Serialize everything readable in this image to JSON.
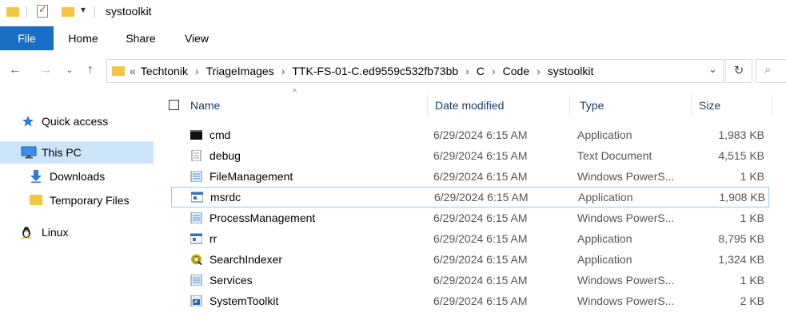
{
  "window": {
    "title": "systoolkit"
  },
  "ribbon": {
    "tabs": [
      "File",
      "Home",
      "Share",
      "View"
    ]
  },
  "address": {
    "prefix": "«",
    "crumbs": [
      "Techtonik",
      "TriageImages",
      "TTK-FS-01-C.ed9559c532fb73bb",
      "C",
      "Code",
      "systoolkit"
    ]
  },
  "sidebar": {
    "items": [
      {
        "label": "Quick access",
        "icon": "star-icon"
      },
      {
        "label": "This PC",
        "icon": "monitor-icon",
        "selected": true
      },
      {
        "label": "Downloads",
        "icon": "download-arrow-icon"
      },
      {
        "label": "Temporary Files",
        "icon": "folder-icon"
      },
      {
        "label": "Linux",
        "icon": "linux-penguin-icon"
      }
    ]
  },
  "columns": {
    "name": "Name",
    "date": "Date modified",
    "type": "Type",
    "size": "Size"
  },
  "files": [
    {
      "name": "cmd",
      "date": "6/29/2024 6:15 AM",
      "type": "Application",
      "size": "1,983 KB",
      "icon": "console-icon"
    },
    {
      "name": "debug",
      "date": "6/29/2024 6:15 AM",
      "type": "Text Document",
      "size": "4,515 KB",
      "icon": "text-file-icon"
    },
    {
      "name": "FileManagement",
      "date": "6/29/2024 6:15 AM",
      "type": "Windows PowerS...",
      "size": "1 KB",
      "icon": "powershell-script-icon"
    },
    {
      "name": "msrdc",
      "date": "6/29/2024 6:15 AM",
      "type": "Application",
      "size": "1,908 KB",
      "icon": "app-window-icon",
      "selected": true
    },
    {
      "name": "ProcessManagement",
      "date": "6/29/2024 6:15 AM",
      "type": "Windows PowerS...",
      "size": "1 KB",
      "icon": "powershell-script-icon"
    },
    {
      "name": "rr",
      "date": "6/29/2024 6:15 AM",
      "type": "Application",
      "size": "8,795 KB",
      "icon": "app-window-icon"
    },
    {
      "name": "SearchIndexer",
      "date": "6/29/2024 6:15 AM",
      "type": "Application",
      "size": "1,324 KB",
      "icon": "search-indexer-icon"
    },
    {
      "name": "Services",
      "date": "6/29/2024 6:15 AM",
      "type": "Windows PowerS...",
      "size": "1 KB",
      "icon": "powershell-script-icon"
    },
    {
      "name": "SystemToolkit",
      "date": "6/29/2024 6:15 AM",
      "type": "Windows PowerS...",
      "size": "2 KB",
      "icon": "powershell-shortcut-icon"
    }
  ]
}
